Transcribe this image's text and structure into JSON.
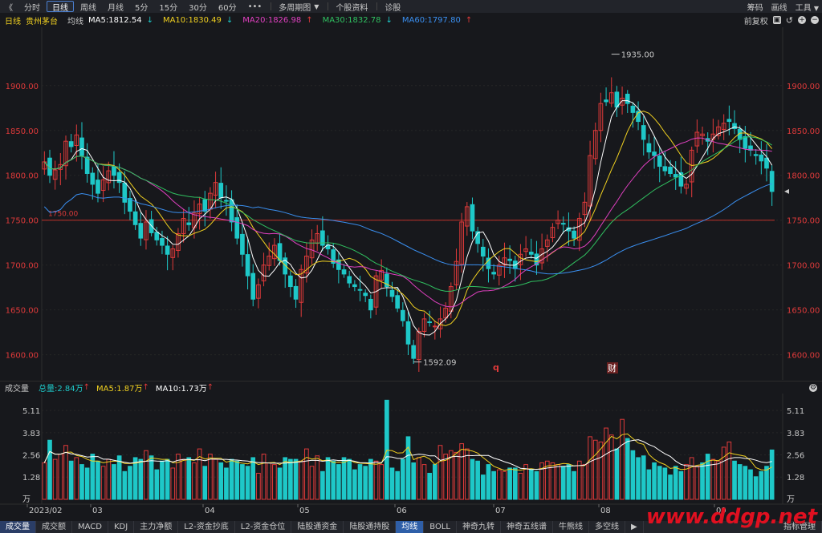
{
  "toolbar": {
    "back_glyph": "《",
    "periods": [
      "分时",
      "日线",
      "周线",
      "月线",
      "5分",
      "15分",
      "30分",
      "60分"
    ],
    "active": "日线",
    "more_glyph": "•••",
    "multi_period": "多周期图",
    "stock_info": "个股资料",
    "diagnose": "诊股",
    "right": [
      "筹码",
      "画线",
      "工具"
    ]
  },
  "info": {
    "period": "日线",
    "stock": "贵州茅台",
    "ma_label": "均线",
    "ma5": "MA5:1812.54",
    "ma10": "MA10:1830.49",
    "ma20": "MA20:1826.98",
    "ma30": "MA30:1832.78",
    "ma60": "MA60:1797.80",
    "adjust": "前复权",
    "colors": {
      "ma5": "#ffffff",
      "ma10": "#f0d020",
      "ma20": "#e040c0",
      "ma30": "#30c060",
      "ma60": "#3a8ff0",
      "up": "#e03a3a",
      "down": "#1ec8c8"
    }
  },
  "chart_data": {
    "type": "candlestick",
    "yticks": [
      1900,
      1850,
      1800,
      1750,
      1700,
      1650,
      1600
    ],
    "ytick_labels": [
      "1900.00",
      "1850.00",
      "1800.00",
      "1750.00",
      "1700.00",
      "1650.00",
      "1600.00"
    ],
    "ylim": [
      1572,
      1965
    ],
    "hline": 1750,
    "hline_label": "1750.00",
    "high_label": "1935.00",
    "low_label": "1592.09",
    "event_markers": [
      "q",
      "财"
    ],
    "xlabels": [
      "2023/02",
      "03",
      "04",
      "05",
      "06",
      "07",
      "08",
      "09"
    ],
    "closes": [
      1815,
      1800,
      1806,
      1812,
      1838,
      1832,
      1845,
      1822,
      1802,
      1790,
      1780,
      1795,
      1805,
      1800,
      1792,
      1770,
      1760,
      1745,
      1730,
      1748,
      1736,
      1728,
      1722,
      1712,
      1718,
      1735,
      1752,
      1745,
      1758,
      1768,
      1760,
      1780,
      1792,
      1775,
      1772,
      1748,
      1730,
      1712,
      1688,
      1662,
      1678,
      1700,
      1710,
      1722,
      1705,
      1690,
      1676,
      1662,
      1695,
      1710,
      1728,
      1735,
      1722,
      1718,
      1702,
      1695,
      1690,
      1680,
      1676,
      1672,
      1666,
      1650,
      1688,
      1694,
      1676,
      1665,
      1652,
      1638,
      1612,
      1596,
      1626,
      1640,
      1636,
      1632,
      1640,
      1652,
      1676,
      1704,
      1748,
      1765,
      1738,
      1724,
      1710,
      1696,
      1690,
      1700,
      1708,
      1705,
      1696,
      1712,
      1718,
      1712,
      1700,
      1718,
      1728,
      1742,
      1750,
      1746,
      1738,
      1730,
      1752,
      1770,
      1822,
      1850,
      1880,
      1882,
      1892,
      1876,
      1886,
      1880,
      1870,
      1860,
      1840,
      1826,
      1822,
      1810,
      1805,
      1802,
      1798,
      1788,
      1790,
      1828,
      1848,
      1846,
      1838,
      1846,
      1854,
      1858,
      1860,
      1852,
      1840,
      1830,
      1828,
      1822,
      1816,
      1808,
      1782
    ],
    "volume": {
      "header": "成交量",
      "total": "总量:2.84万",
      "ma5": "MA5:1.87万",
      "ma10": "MA10:1.73万",
      "yticks": [
        "5.11",
        "3.83",
        "2.56",
        "1.28"
      ],
      "unit": "万",
      "values": [
        2.1,
        3.4,
        2.3,
        2.6,
        3.1,
        2.2,
        2.4,
        2.0,
        1.8,
        2.6,
        2.2,
        1.9,
        2.3,
        2.0,
        2.5,
        1.6,
        1.9,
        2.4,
        2.3,
        2.8,
        2.5,
        1.7,
        2.2,
        2.3,
        1.8,
        2.6,
        2.3,
        2.4,
        2.1,
        2.9,
        1.9,
        2.6,
        2.3,
        2.1,
        1.8,
        2.3,
        2.2,
        2.0,
        1.9,
        2.4,
        1.5,
        2.6,
        2.1,
        2.0,
        1.8,
        2.4,
        2.3,
        2.3,
        2.2,
        2.9,
        1.9,
        2.5,
        1.6,
        2.4,
        2.2,
        2.0,
        2.4,
        2.3,
        1.7,
        2.0,
        1.9,
        2.3,
        2.2,
        2.0,
        2.4,
        1.8,
        1.6,
        2.3,
        3.6,
        2.1,
        2.4,
        2.0,
        1.5,
        2.0,
        3.1,
        2.6,
        2.8,
        2.7,
        3.2,
        2.9,
        2.3,
        2.2,
        1.4,
        2.0,
        1.6,
        1.7,
        1.6,
        1.8,
        1.8,
        1.5,
        2.0,
        1.7,
        1.6,
        2.1,
        2.2,
        2.1,
        2.0,
        1.9,
        2.0,
        1.6,
        2.2,
        2.0,
        3.6,
        3.4,
        3.3,
        4.1,
        3.7,
        2.9,
        4.6,
        3.5,
        2.8,
        2.4,
        2.5,
        1.7,
        2.1,
        1.9,
        1.8,
        1.4,
        1.9,
        1.6,
        2.0,
        2.4,
        1.9,
        2.1,
        2.6,
        2.3,
        2.2,
        3.0,
        3.3,
        2.2,
        2.0,
        1.9,
        1.7,
        1.3,
        1.6,
        1.9,
        2.84
      ],
      "spikes": {
        "64": 5.7
      }
    }
  },
  "bottom_tabs": [
    "成交量",
    "成交额",
    "MACD",
    "KDJ",
    "主力净额",
    "L2-资金抄底",
    "L2-资金仓位",
    "陆股通资金",
    "陆股通持股",
    "均线",
    "BOLL",
    "神奇九转",
    "神奇五线谱",
    "牛熊线",
    "多空线"
  ],
  "bottom_right": "指标管理",
  "watermark": "www.ddgp.net"
}
